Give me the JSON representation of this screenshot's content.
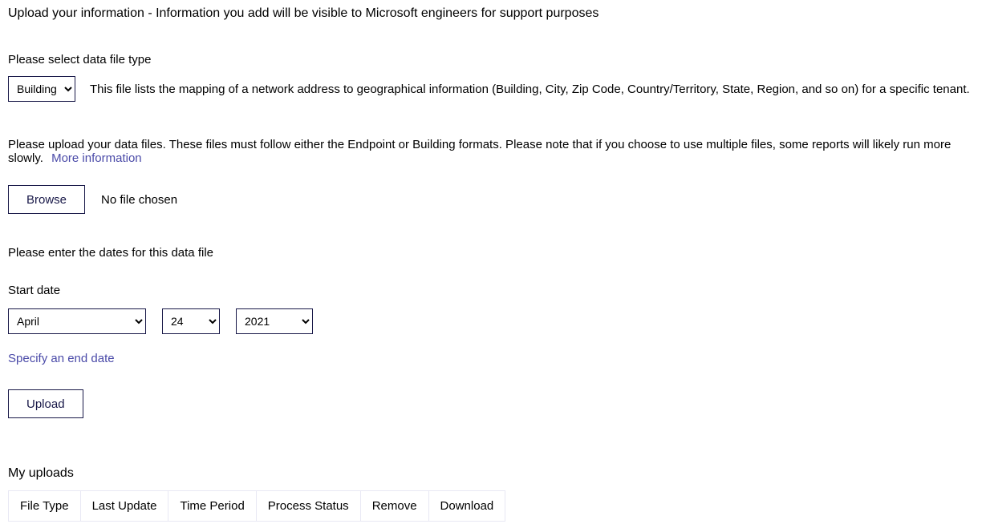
{
  "title": "Upload your information - Information you add will be visible to Microsoft engineers for support purposes",
  "fileTypeSection": {
    "label": "Please select data file type",
    "selected": "Building",
    "description": "This file lists the mapping of a network address to geographical information (Building, City, Zip Code, Country/Territory, State, Region, and so on) for a specific tenant."
  },
  "uploadSection": {
    "description": "Please upload your data files. These files must follow either the Endpoint or Building formats. Please note that if you choose to use multiple files, some reports will likely run more slowly.",
    "moreInfoLink": "More information",
    "browseButton": "Browse",
    "noFile": "No file chosen"
  },
  "datesSection": {
    "label": "Please enter the dates for this data file",
    "startLabel": "Start date",
    "month": "April",
    "day": "24",
    "year": "2021",
    "endDateLink": "Specify an end date"
  },
  "uploadButton": "Upload",
  "myUploads": {
    "title": "My uploads",
    "columns": [
      "File Type",
      "Last Update",
      "Time Period",
      "Process Status",
      "Remove",
      "Download"
    ]
  }
}
